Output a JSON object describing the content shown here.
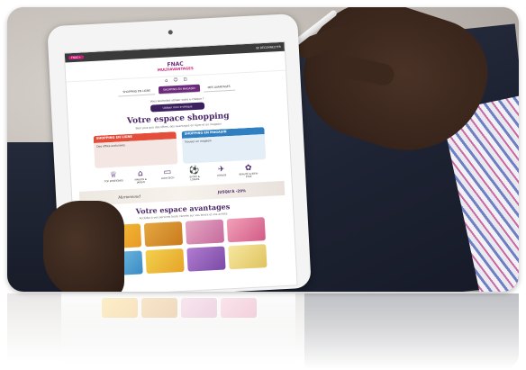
{
  "tablet": {
    "topbar_left": "FNAC+",
    "topbar_right": "SE DÉCONNECTER",
    "logo_top": "FNAC",
    "logo_bottom": "MULTIAVANTAGES",
    "nav": [
      "SHOPPING EN LIGNE",
      "SHOPPING EN MAGASIN",
      "MES AVANTAGES"
    ],
    "hint": "Vous souhaitez utiliser votre e-chèque ?",
    "cta": "Utiliser mon e-chèque",
    "shopping_title": "Votre espace shopping",
    "shopping_sub": "Bien plus que des offres, des avantages en ligne et en magasin",
    "card_online_title": "SHOPPING EN LIGNE",
    "card_online_body": "Des offres exclusives",
    "card_store_title": "SHOPPING EN MAGASIN",
    "card_store_body": "Trouver un magasin",
    "categories": [
      "TOP ENSEIGNES",
      "MAISON & JARDIN",
      "HIGH-TECH",
      "SPORT & LOISIRS",
      "VOYAGE",
      "BEAUTÉ & BIEN-ÊTRE"
    ],
    "banner_left": "Marionnaud",
    "banner_right": "JUSQU'À -20%",
    "avantages_title": "Votre espace avantages",
    "avantages_sub": "Accédez à vos services toute l'année sur vos loisirs et vos achats"
  },
  "colors": {
    "brand_purple": "#4a2568",
    "brand_pink": "#c8207a",
    "card_red": "#e44d3a",
    "card_blue": "#2f7fc1"
  }
}
